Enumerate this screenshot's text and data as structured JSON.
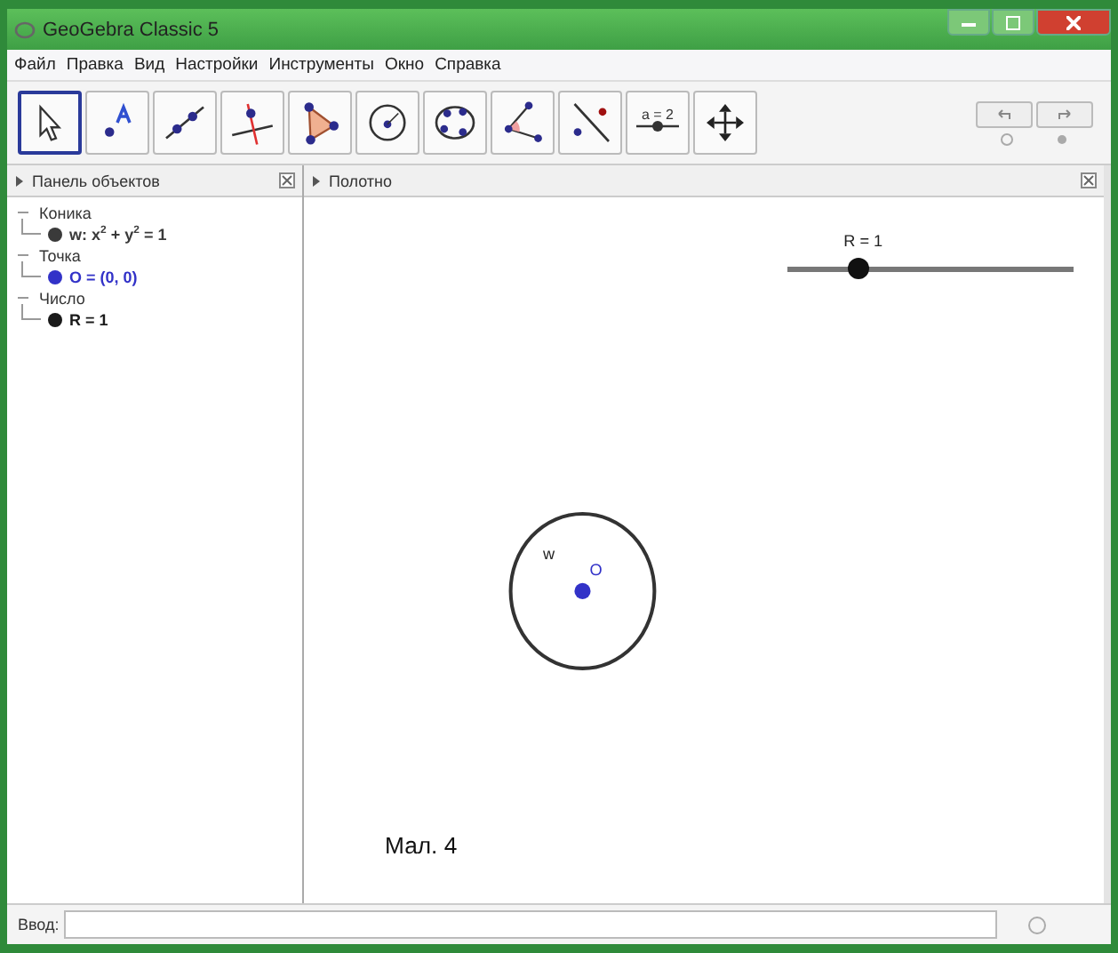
{
  "window": {
    "title": "GeoGebra Classic 5"
  },
  "menu": [
    "Файл",
    "Правка",
    "Вид",
    "Настройки",
    "Инструменты",
    "Окно",
    "Справка"
  ],
  "toolbar": [
    {
      "kind": "move",
      "selected": true
    },
    {
      "kind": "point",
      "selected": false
    },
    {
      "kind": "line",
      "selected": false
    },
    {
      "kind": "perpendicular",
      "selected": false
    },
    {
      "kind": "polygon",
      "selected": false
    },
    {
      "kind": "circle",
      "selected": false
    },
    {
      "kind": "conic",
      "selected": false
    },
    {
      "kind": "angle",
      "selected": false
    },
    {
      "kind": "reflect",
      "selected": false
    },
    {
      "kind": "slider",
      "label": "a = 2",
      "selected": false
    },
    {
      "kind": "move-view",
      "selected": false
    }
  ],
  "algebra": {
    "title": "Панель объектов",
    "children": [
      {
        "label": "Коника",
        "children": [
          {
            "label": "w: x$^{2}$ + y$^{2}$ = 1",
            "color": "#3a3a3a"
          }
        ]
      },
      {
        "label": "Точка",
        "children": [
          {
            "label": "O = (0, 0)",
            "color": "#3232c8"
          }
        ]
      },
      {
        "label": "Число",
        "children": [
          {
            "label": "R = 1",
            "color": "#1a1a1a"
          }
        ]
      }
    ]
  },
  "graphics": {
    "title": "Полотно",
    "slider": {
      "label": "R = 1",
      "level": 0.25
    },
    "conic_label": "w",
    "point_label": "O",
    "caption": "Мал. 4"
  },
  "input_bar": {
    "label": "Ввод:"
  }
}
